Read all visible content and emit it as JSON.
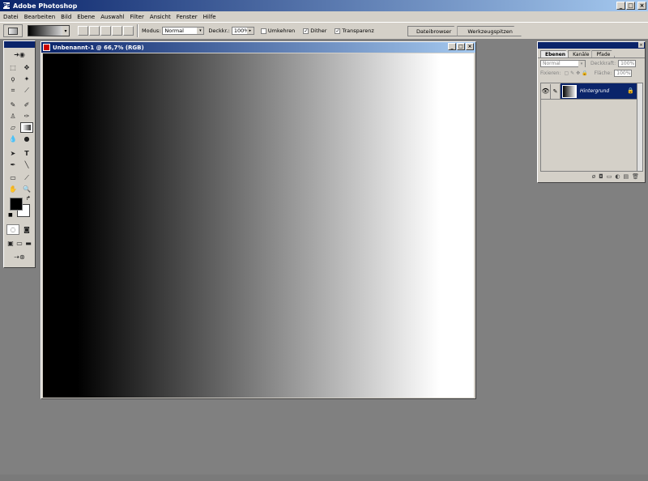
{
  "app": {
    "title": "Adobe Photoshop"
  },
  "menu": [
    "Datei",
    "Bearbeiten",
    "Bild",
    "Ebene",
    "Auswahl",
    "Filter",
    "Ansicht",
    "Fenster",
    "Hilfe"
  ],
  "options": {
    "mode_label": "Modus:",
    "mode_value": "Normal",
    "opacity_label": "Deckkr.:",
    "opacity_value": "100%",
    "reverse_label": "Umkehren",
    "reverse_checked": false,
    "dither_label": "Dither",
    "dither_checked": true,
    "transparency_label": "Transparenz",
    "transparency_checked": true
  },
  "palette_well": [
    "Dateibrowser",
    "Werkzeugspitzen"
  ],
  "document": {
    "title": "Unbenannt-1 @ 66,7% (RGB)"
  },
  "layers_panel": {
    "tabs": [
      "Ebenen",
      "Kanäle",
      "Pfade"
    ],
    "active_tab": "Ebenen",
    "blend_mode": "Normal",
    "opacity_label": "Deckkraft:",
    "opacity_value": "100%",
    "lock_label": "Fixieren:",
    "fill_label": "Fläche:",
    "fill_value": "100%",
    "layers": [
      {
        "name": "Hintergrund"
      }
    ]
  },
  "colors": {
    "accent": "#0a246a",
    "chrome": "#d4d0c8",
    "workspace": "#808080"
  }
}
